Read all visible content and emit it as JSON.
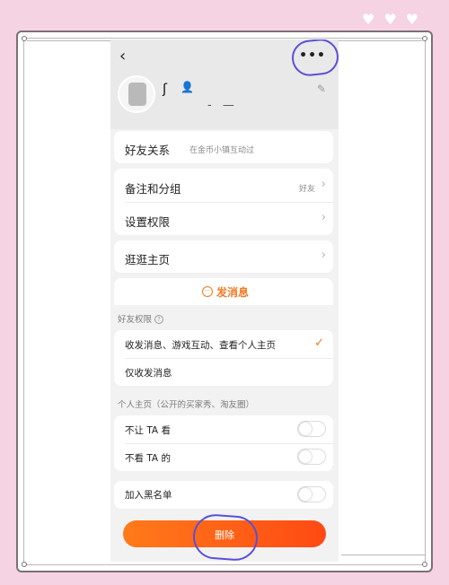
{
  "header": {
    "back_icon": "chevron-left-icon",
    "more_icon": "more-dots-icon"
  },
  "profile": {
    "name_fragment": "ʃ",
    "name_tail": "‑ —",
    "edit_icon": "pencil-icon",
    "verified_icon": "person-badge-icon"
  },
  "friend_relation": {
    "label": "好友关系",
    "sub": "在金币小镇互动过"
  },
  "settings_rows": [
    {
      "label": "备注和分组",
      "value": "好友"
    },
    {
      "label": "设置权限",
      "value": ""
    }
  ],
  "visit_home": {
    "label": "逛逛主页"
  },
  "send_message": {
    "label": "发消息",
    "icon": "chat-bubble-icon"
  },
  "permissions": {
    "title": "好友权限",
    "options": [
      {
        "label": "收发消息、游戏互动、查看个人主页",
        "selected": true
      },
      {
        "label": "仅收发消息",
        "selected": false
      }
    ]
  },
  "personal_home": {
    "title": "个人主页（公开的买家秀、淘友圈）",
    "toggles": [
      {
        "label": "不让 TA 看",
        "on": false
      },
      {
        "label": "不看 TA 的",
        "on": false
      }
    ]
  },
  "blacklist": {
    "label": "加入黑名单",
    "on": false
  },
  "delete": {
    "label": "删除"
  },
  "colors": {
    "accent": "#f07a22",
    "annotation": "#5a4fd8",
    "background": "#f6d3e2"
  }
}
